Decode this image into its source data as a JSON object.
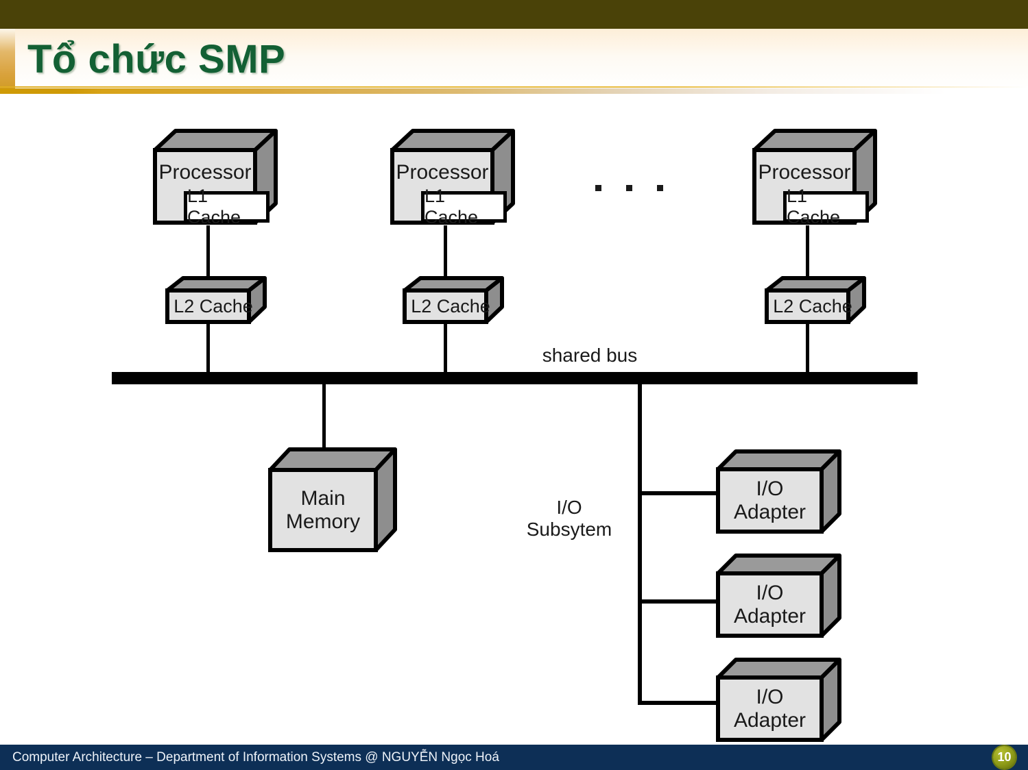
{
  "slide": {
    "title": "Tổ chức SMP",
    "title_color": "#136034",
    "header_bar_color": "#4a4208",
    "accent_gold": "#cf9a06"
  },
  "diagram": {
    "type": "block-diagram",
    "bus_label": "shared bus",
    "io_subsystem_label": "I/O\nSubsytem",
    "ellipsis": "...",
    "processors": [
      {
        "label": "Processor",
        "cache_label": "L1 Cache",
        "l2_label": "L2 Cache"
      },
      {
        "label": "Processor",
        "cache_label": "L1 Cache",
        "l2_label": "L2 Cache"
      },
      {
        "label": "Processor",
        "cache_label": "L1 Cache",
        "l2_label": "L2 Cache"
      }
    ],
    "main_memory_label": "Main\nMemory",
    "io_adapters": [
      {
        "label": "I/O\nAdapter"
      },
      {
        "label": "I/O\nAdapter"
      },
      {
        "label": "I/O\nAdapter"
      }
    ]
  },
  "footer": {
    "text": "Computer Architecture – Department of Information Systems @ NGUYỄN Ngọc Hoá",
    "page_number": "10",
    "background": "#0d2f56"
  }
}
